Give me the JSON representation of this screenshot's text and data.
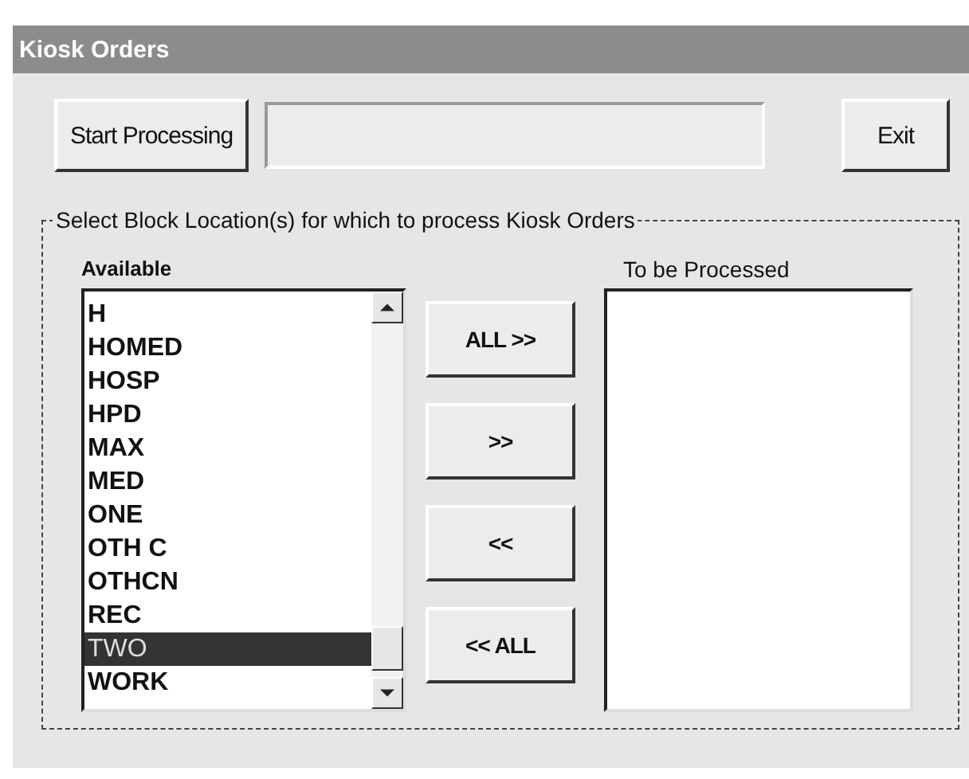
{
  "window": {
    "title": "Kiosk Orders"
  },
  "toolbar": {
    "start_button": "Start Processing",
    "status_field": {
      "disabled": true
    },
    "exit_button": "Exit"
  },
  "group": {
    "title": "Select Block Location(s) for which to process Kiosk Orders",
    "available": {
      "label": "Available",
      "items": [
        {
          "text": "H",
          "selected": false
        },
        {
          "text": "HOMED",
          "selected": false
        },
        {
          "text": "HOSP",
          "selected": false
        },
        {
          "text": "HPD",
          "selected": false
        },
        {
          "text": "MAX",
          "selected": false
        },
        {
          "text": "MED",
          "selected": false
        },
        {
          "text": "ONE",
          "selected": false
        },
        {
          "text": "OTH C",
          "selected": false
        },
        {
          "text": "OTHCN",
          "selected": false
        },
        {
          "text": "REC",
          "selected": false
        },
        {
          "text": "TWO",
          "selected": true
        },
        {
          "text": "WORK",
          "selected": false
        }
      ]
    },
    "move_buttons": [
      "ALL >>",
      ">>",
      "<<",
      "<< ALL"
    ],
    "to_be_processed": {
      "label": "To be Processed"
    }
  }
}
